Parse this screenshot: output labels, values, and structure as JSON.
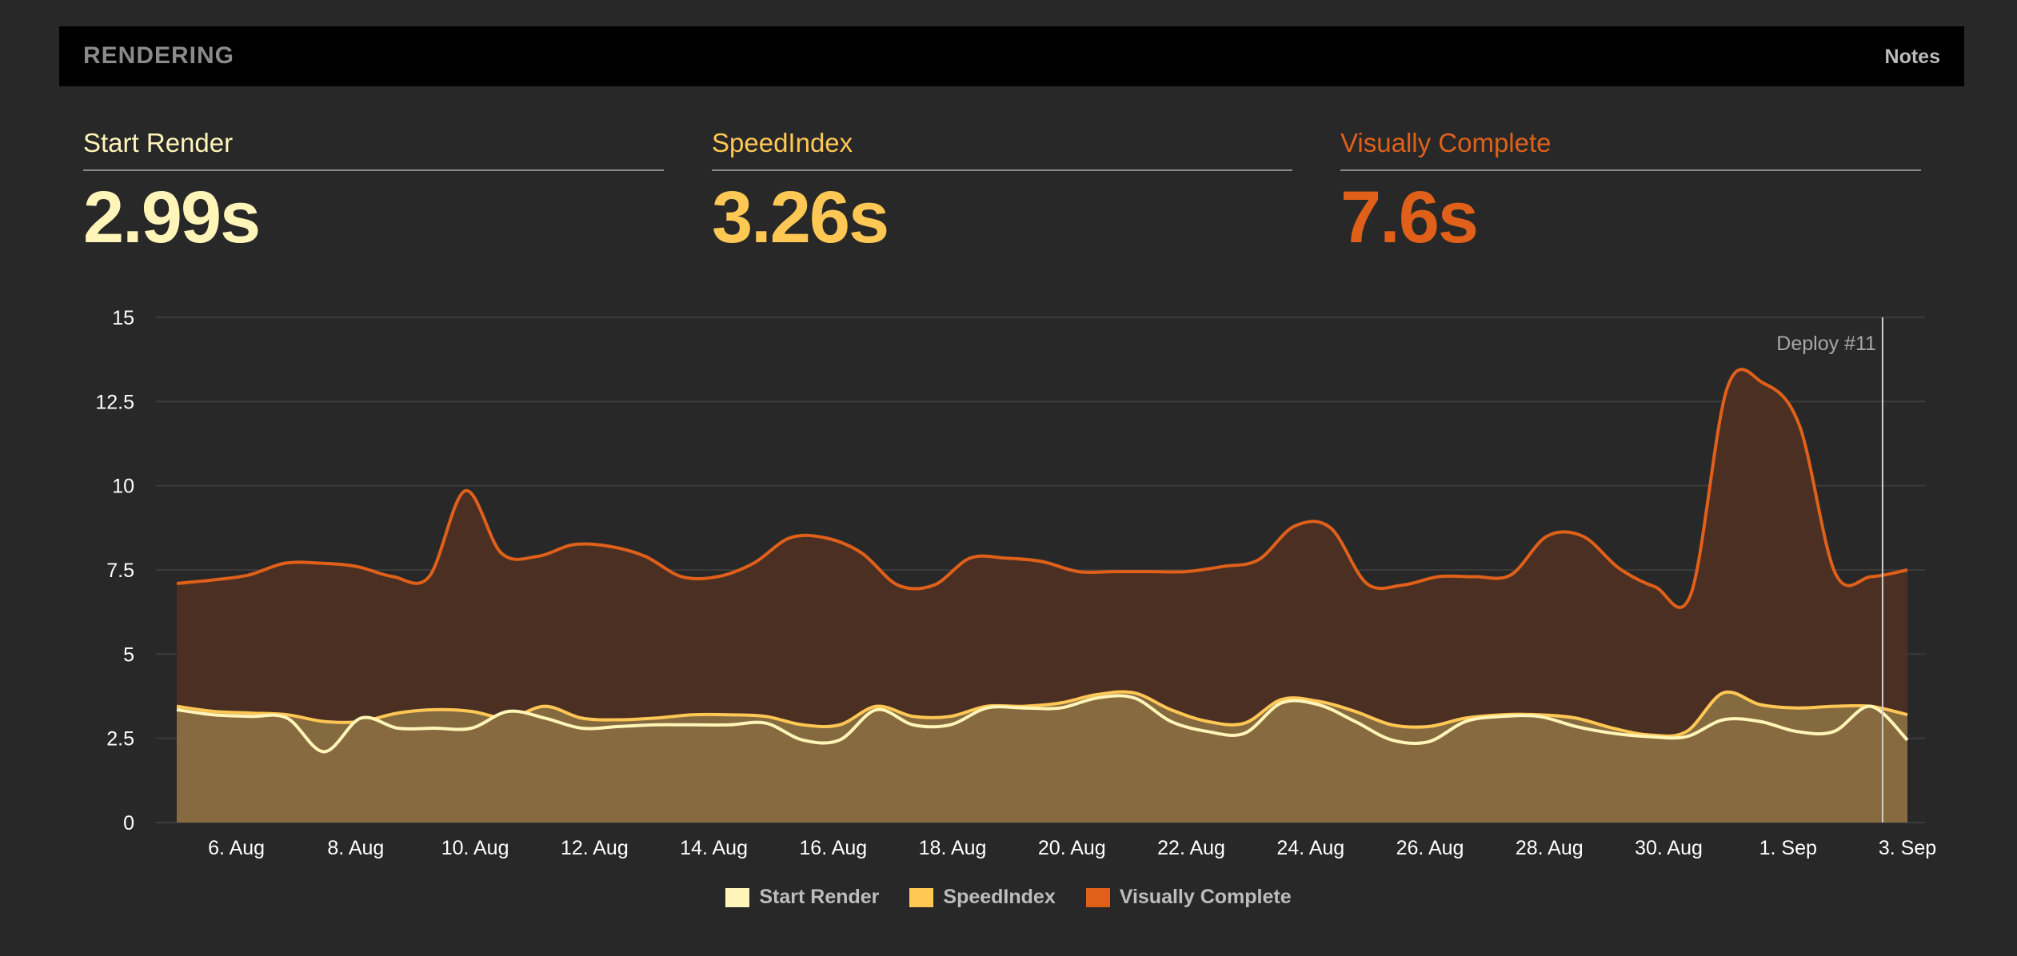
{
  "header": {
    "title": "RENDERING",
    "notes_label": "Notes"
  },
  "metrics": [
    {
      "label": "Start Render",
      "value": "2.99s",
      "color": "#fff5b8"
    },
    {
      "label": "SpeedIndex",
      "value": "3.26s",
      "color": "#ffc753"
    },
    {
      "label": "Visually Complete",
      "value": "7.6s",
      "color": "#e0601a"
    }
  ],
  "chart_data": {
    "type": "area",
    "x_start": "2023-08-05",
    "x_end": "2023-09-03",
    "x_tick_labels": [
      "6. Aug",
      "8. Aug",
      "10. Aug",
      "12. Aug",
      "14. Aug",
      "16. Aug",
      "18. Aug",
      "20. Aug",
      "22. Aug",
      "24. Aug",
      "26. Aug",
      "28. Aug",
      "30. Aug",
      "1. Sep",
      "3. Sep"
    ],
    "ylim": [
      0,
      15
    ],
    "y_ticks": [
      0,
      2.5,
      5,
      7.5,
      10,
      12.5,
      15
    ],
    "y_tick_labels": [
      "0",
      "2.5",
      "5",
      "7.5",
      "10",
      "12.5",
      "15"
    ],
    "grid": true,
    "legend_position": "bottom-center",
    "annotation": {
      "label": "Deploy #11",
      "x": "2023-09-02T14:00"
    },
    "x_dates": [
      "2023-08-05",
      "2023-08-05T12:00",
      "2023-08-06",
      "2023-08-06T12:00",
      "2023-08-07",
      "2023-08-07T12:00",
      "2023-08-08",
      "2023-08-08T12:00",
      "2023-08-09",
      "2023-08-09T12:00",
      "2023-08-10",
      "2023-08-10T12:00",
      "2023-08-11",
      "2023-08-11T12:00",
      "2023-08-12",
      "2023-08-12T12:00",
      "2023-08-13",
      "2023-08-13T12:00",
      "2023-08-14",
      "2023-08-14T12:00",
      "2023-08-15",
      "2023-08-15T12:00",
      "2023-08-16",
      "2023-08-16T12:00",
      "2023-08-17",
      "2023-08-17T12:00",
      "2023-08-18",
      "2023-08-18T12:00",
      "2023-08-19",
      "2023-08-19T12:00",
      "2023-08-20",
      "2023-08-20T12:00",
      "2023-08-21",
      "2023-08-21T12:00",
      "2023-08-22",
      "2023-08-22T12:00",
      "2023-08-23",
      "2023-08-23T12:00",
      "2023-08-24",
      "2023-08-24T12:00",
      "2023-08-25",
      "2023-08-25T12:00",
      "2023-08-26",
      "2023-08-26T12:00",
      "2023-08-27",
      "2023-08-27T12:00",
      "2023-08-28",
      "2023-08-28T12:00",
      "2023-08-29",
      "2023-08-29T12:00",
      "2023-08-30",
      "2023-08-30T12:00",
      "2023-08-31",
      "2023-08-31T12:00",
      "2023-09-01",
      "2023-09-01T12:00",
      "2023-09-02",
      "2023-09-02T12:00",
      "2023-09-03"
    ],
    "series": [
      {
        "name": "Visually Complete",
        "color": "#e0601a",
        "values": [
          7.1,
          7.2,
          7.35,
          7.7,
          7.7,
          7.6,
          7.3,
          7.3,
          9.85,
          8.0,
          7.9,
          8.25,
          8.2,
          7.9,
          7.3,
          7.3,
          7.7,
          8.45,
          8.45,
          8.0,
          7.05,
          7.05,
          7.85,
          7.85,
          7.75,
          7.45,
          7.45,
          7.45,
          7.45,
          7.6,
          7.8,
          8.8,
          8.75,
          7.1,
          7.05,
          7.3,
          7.3,
          7.35,
          8.5,
          8.5,
          7.55,
          7.0,
          6.8,
          12.9,
          13.05,
          11.8,
          7.4,
          7.3,
          7.5
        ]
      },
      {
        "name": "SpeedIndex",
        "color": "#ffc753",
        "values": [
          3.45,
          3.3,
          3.25,
          3.2,
          3.0,
          3.0,
          3.25,
          3.35,
          3.3,
          3.1,
          3.45,
          3.1,
          3.05,
          3.1,
          3.2,
          3.2,
          3.15,
          2.9,
          2.9,
          3.45,
          3.15,
          3.15,
          3.45,
          3.45,
          3.55,
          3.8,
          3.85,
          3.35,
          3.0,
          2.95,
          3.65,
          3.6,
          3.3,
          2.9,
          2.85,
          3.1,
          3.2,
          3.2,
          3.1,
          2.8,
          2.6,
          2.7,
          3.85,
          3.5,
          3.4,
          3.45,
          3.45,
          3.2
        ]
      },
      {
        "name": "Start Render",
        "color": "#fff5b8",
        "values": [
          3.35,
          3.2,
          3.15,
          3.1,
          2.1,
          3.1,
          2.8,
          2.8,
          2.8,
          3.3,
          3.1,
          2.8,
          2.85,
          2.9,
          2.9,
          2.9,
          2.95,
          2.45,
          2.45,
          3.35,
          2.9,
          2.9,
          3.4,
          3.4,
          3.4,
          3.7,
          3.7,
          3.0,
          2.7,
          2.65,
          3.55,
          3.5,
          3.0,
          2.45,
          2.4,
          3.0,
          3.15,
          3.15,
          2.85,
          2.65,
          2.55,
          2.55,
          3.05,
          3.0,
          2.7,
          2.7,
          3.45,
          2.45
        ]
      }
    ]
  }
}
